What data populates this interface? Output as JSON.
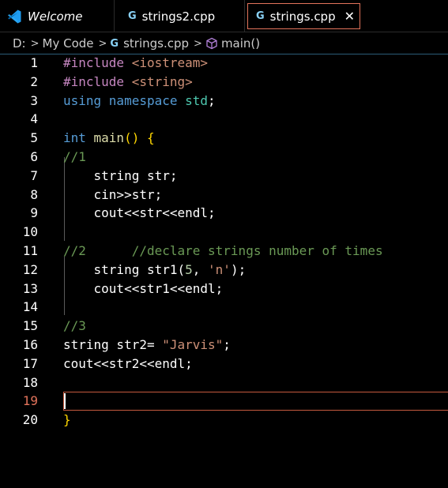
{
  "tabs": [
    {
      "label": "Welcome",
      "icon": "vscode-logo-icon"
    },
    {
      "label": "strings2.cpp",
      "icon": "cpp-file-icon"
    },
    {
      "label": "strings.cpp",
      "icon": "cpp-file-icon",
      "active": true
    }
  ],
  "tab_icon_glyph": "G",
  "close_glyph": "✕",
  "breadcrumb": {
    "drive": "D:",
    "folder": "My Code",
    "file": "strings.cpp",
    "symbol": "main()",
    "separator": ">"
  },
  "editor": {
    "active_line": 19,
    "lines": [
      {
        "n": "1",
        "tokens": [
          [
            "pp",
            "#include "
          ],
          [
            "inc",
            "<iostream>"
          ]
        ]
      },
      {
        "n": "2",
        "tokens": [
          [
            "pp",
            "#include "
          ],
          [
            "inc",
            "<string>"
          ]
        ]
      },
      {
        "n": "3",
        "tokens": [
          [
            "kw",
            "using "
          ],
          [
            "kw",
            "namespace "
          ],
          [
            "ty",
            "std"
          ],
          [
            "pl",
            ";"
          ]
        ]
      },
      {
        "n": "4",
        "tokens": []
      },
      {
        "n": "5",
        "tokens": [
          [
            "kw",
            "int "
          ],
          [
            "fn",
            "main"
          ],
          [
            "br",
            "() {"
          ]
        ]
      },
      {
        "n": "6",
        "tokens": [
          [
            "cm",
            "//1"
          ]
        ]
      },
      {
        "n": "7",
        "tokens": [
          [
            "pl",
            "    string str;"
          ]
        ]
      },
      {
        "n": "8",
        "tokens": [
          [
            "pl",
            "    cin>>str;"
          ]
        ]
      },
      {
        "n": "9",
        "tokens": [
          [
            "pl",
            "    cout<<str<<endl;"
          ]
        ]
      },
      {
        "n": "10",
        "tokens": []
      },
      {
        "n": "11",
        "tokens": [
          [
            "cm",
            "//2      //declare strings number of times"
          ]
        ]
      },
      {
        "n": "12",
        "tokens": [
          [
            "pl",
            "    string str1("
          ],
          [
            "num",
            "5"
          ],
          [
            "pl",
            ", "
          ],
          [
            "str",
            "'n'"
          ],
          [
            "pl",
            ");"
          ]
        ]
      },
      {
        "n": "13",
        "tokens": [
          [
            "pl",
            "    cout<<str1<<endl;"
          ]
        ]
      },
      {
        "n": "14",
        "tokens": []
      },
      {
        "n": "15",
        "tokens": [
          [
            "cm",
            "//3"
          ]
        ]
      },
      {
        "n": "16",
        "tokens": [
          [
            "pl",
            "string str2= "
          ],
          [
            "str",
            "\"Jarvis\""
          ],
          [
            "pl",
            ";"
          ]
        ]
      },
      {
        "n": "17",
        "tokens": [
          [
            "pl",
            "cout<<str2<<endl;"
          ]
        ]
      },
      {
        "n": "18",
        "tokens": []
      },
      {
        "n": "19",
        "tokens": []
      },
      {
        "n": "20",
        "tokens": [
          [
            "br",
            "}"
          ]
        ]
      }
    ]
  }
}
